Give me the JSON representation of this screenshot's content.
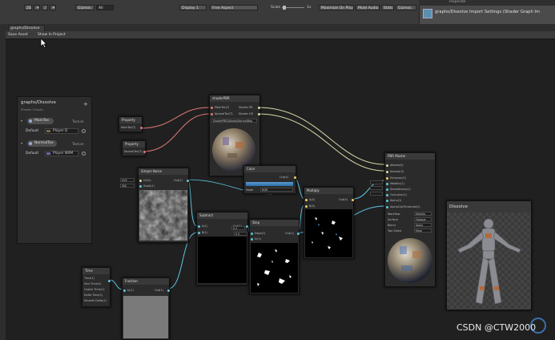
{
  "toolbar": {
    "mode_2d": "2D",
    "gizmos": "Gizmos",
    "all": "All",
    "display": "Display 1",
    "aspect": "Free Aspect",
    "scale_label": "Scale",
    "scale_value": "1x",
    "maximize": "Maximize On Play",
    "mute": "Mute Audio",
    "stats": "Stats",
    "gizmos2": "Gizmos"
  },
  "inspector": {
    "title": "Inspector",
    "asset_title": "graphs/Dissolve Import Settings (Shader Graph Im"
  },
  "graph_window": {
    "tab": "graphs/Dissolve",
    "save_asset": "Save Asset",
    "show_in_project": "Show In Project"
  },
  "blackboard": {
    "title": "graphs/Dissolve",
    "subtitle": "Shader Graphs",
    "add": "+",
    "properties": [
      {
        "name": "MainTex",
        "type": "Texture",
        "default_label": "Default",
        "default_value": "Player D"
      },
      {
        "name": "NormalTex",
        "type": "Texture",
        "default_label": "Default",
        "default_value": "Player NRM"
      }
    ]
  },
  "nodes": {
    "prop1": {
      "title": "Property",
      "out": "MainTex(T)"
    },
    "prop2": {
      "title": "Property",
      "out": "NormalTex(T)"
    },
    "shader_pbr": {
      "title": "shaderPBR",
      "in1": "MainTex(T)",
      "in2": "NormalTex(T)",
      "out1": "Shader PB",
      "out2": "Shader GR",
      "field": "ShaderPBR(Albedo)NormalMap"
    },
    "simple_noise": {
      "title": "Simple Noise",
      "in1": "UV(2)",
      "in2": "Scale(1)",
      "out": "Out(1)",
      "f1": "UV0",
      "f2": "500"
    },
    "time": {
      "title": "Time",
      "outs": [
        "Time(1)",
        "Sine Time(1)",
        "Cosine Time(1)",
        "Delta Time(1)",
        "Smooth Delta(1)"
      ]
    },
    "fraction": {
      "title": "Fraction",
      "in": "In(1)",
      "out": "Out(1)"
    },
    "subtract": {
      "title": "Subtract",
      "in1": "A(1)",
      "in2": "B(1)",
      "out": "Out(1)",
      "field": "X 0"
    },
    "step": {
      "title": "Step",
      "in1": "Edge(1)",
      "in2": "In(1)",
      "out": "Out(1)",
      "field": "X 0"
    },
    "color": {
      "title": "Color",
      "out": "Out(4)",
      "mode_label": "Mode",
      "mode_value": "HDR"
    },
    "multiply": {
      "title": "Multiply",
      "in1": "A(4)",
      "in2": "B(4)",
      "out": "Out(4)"
    },
    "pbr_master": {
      "title": "PBR Master",
      "ports": [
        "Albedo(3)",
        "Normal(3)",
        "Emission(3)",
        "Metallic(1)",
        "Smoothness(1)",
        "Occlusion(1)",
        "Alpha(1)",
        "AlphaClipThreshold(1)"
      ],
      "settings": [
        {
          "label": "Workflow",
          "value": "Metallic"
        },
        {
          "label": "Surface",
          "value": "Opaque"
        },
        {
          "label": "Blend",
          "value": "Alpha"
        },
        {
          "label": "Two Sided",
          "value": "False"
        }
      ]
    },
    "preview": {
      "title": "Dissolve"
    }
  },
  "watermark": "CSDN @CTW2000",
  "colors": {
    "texture_wire": "#e07878",
    "pbr_wire": "#d8d8a8",
    "float_wire": "#5fc4e0",
    "vec_wire": "#5fc4e0"
  }
}
